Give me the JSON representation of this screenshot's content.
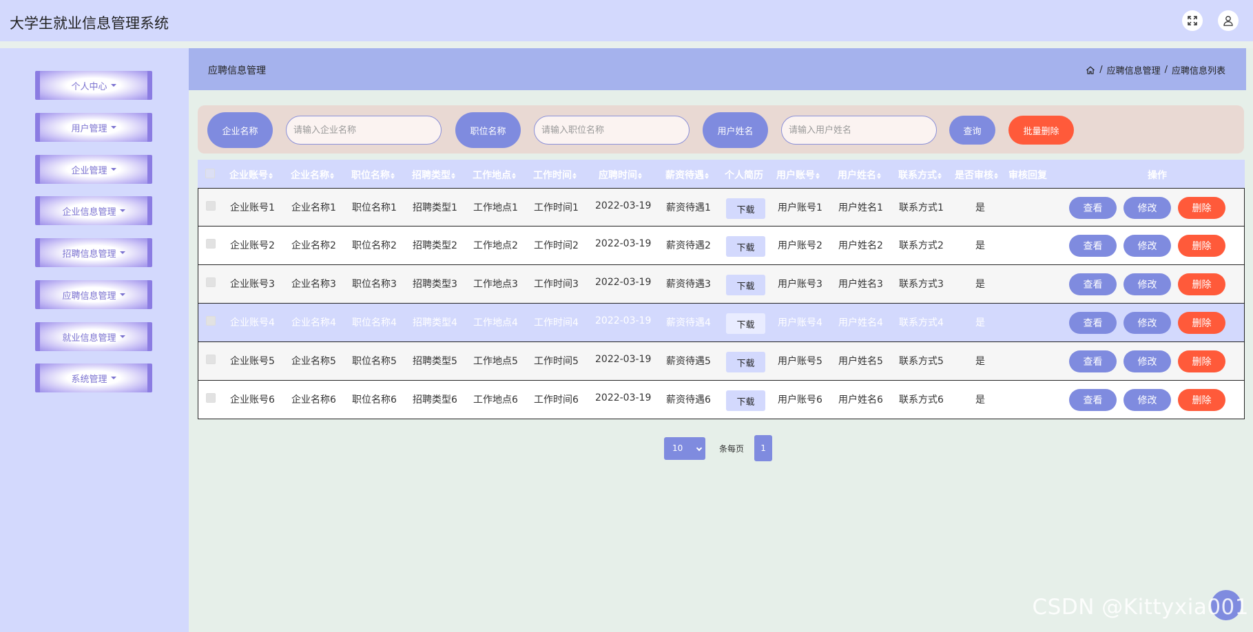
{
  "app": {
    "title": "大学生就业信息管理系统"
  },
  "sidebar": {
    "items": [
      {
        "label": "个人中心"
      },
      {
        "label": "用户管理"
      },
      {
        "label": "企业管理"
      },
      {
        "label": "企业信息管理"
      },
      {
        "label": "招聘信息管理"
      },
      {
        "label": "应聘信息管理"
      },
      {
        "label": "就业信息管理"
      },
      {
        "label": "系统管理"
      }
    ]
  },
  "page": {
    "title": "应聘信息管理",
    "breadcrumb": [
      "应聘信息管理",
      "应聘信息列表"
    ],
    "breadcrumb_sep": "/"
  },
  "search": {
    "company_label": "企业名称",
    "company_placeholder": "请输入企业名称",
    "position_label": "职位名称",
    "position_placeholder": "请输入职位名称",
    "user_label": "用户姓名",
    "user_placeholder": "请输入用户姓名",
    "query_label": "查询",
    "batch_delete_label": "批量删除"
  },
  "table": {
    "headers": [
      "企业账号",
      "企业名称",
      "职位名称",
      "招聘类型",
      "工作地点",
      "工作时间",
      "应聘时间",
      "薪资待遇",
      "个人简历",
      "用户账号",
      "用户姓名",
      "联系方式",
      "是否审核",
      "审核回复",
      "操作"
    ],
    "download_label": "下载",
    "view_label": "查看",
    "edit_label": "修改",
    "delete_label": "删除",
    "rows": [
      {
        "company_account": "企业账号1",
        "company_name": "企业名称1",
        "position": "职位名称1",
        "type": "招聘类型1",
        "location": "工作地点1",
        "work_time": "工作时间1",
        "apply_time": "2022-03-19",
        "salary": "薪资待遇1",
        "user_account": "用户账号1",
        "user_name": "用户姓名1",
        "contact": "联系方式1",
        "reviewed": "是"
      },
      {
        "company_account": "企业账号2",
        "company_name": "企业名称2",
        "position": "职位名称2",
        "type": "招聘类型2",
        "location": "工作地点2",
        "work_time": "工作时间2",
        "apply_time": "2022-03-19",
        "salary": "薪资待遇2",
        "user_account": "用户账号2",
        "user_name": "用户姓名2",
        "contact": "联系方式2",
        "reviewed": "是"
      },
      {
        "company_account": "企业账号3",
        "company_name": "企业名称3",
        "position": "职位名称3",
        "type": "招聘类型3",
        "location": "工作地点3",
        "work_time": "工作时间3",
        "apply_time": "2022-03-19",
        "salary": "薪资待遇3",
        "user_account": "用户账号3",
        "user_name": "用户姓名3",
        "contact": "联系方式3",
        "reviewed": "是"
      },
      {
        "company_account": "企业账号4",
        "company_name": "企业名称4",
        "position": "职位名称4",
        "type": "招聘类型4",
        "location": "工作地点4",
        "work_time": "工作时间4",
        "apply_time": "2022-03-19",
        "salary": "薪资待遇4",
        "user_account": "用户账号4",
        "user_name": "用户姓名4",
        "contact": "联系方式4",
        "reviewed": "是"
      },
      {
        "company_account": "企业账号5",
        "company_name": "企业名称5",
        "position": "职位名称5",
        "type": "招聘类型5",
        "location": "工作地点5",
        "work_time": "工作时间5",
        "apply_time": "2022-03-19",
        "salary": "薪资待遇5",
        "user_account": "用户账号5",
        "user_name": "用户姓名5",
        "contact": "联系方式5",
        "reviewed": "是"
      },
      {
        "company_account": "企业账号6",
        "company_name": "企业名称6",
        "position": "职位名称6",
        "type": "招聘类型6",
        "location": "工作地点6",
        "work_time": "工作时间6",
        "apply_time": "2022-03-19",
        "salary": "薪资待遇6",
        "user_account": "用户账号6",
        "user_name": "用户姓名6",
        "contact": "联系方式6",
        "reviewed": "是"
      }
    ]
  },
  "pagination": {
    "page_size": "10",
    "per_page_label": "条每页",
    "current_page": "1"
  },
  "watermark": "CSDN @Kittyxia001",
  "colors": {
    "accent": "#7f8bdf",
    "danger": "#ff5a3a",
    "sidebar_bg": "#d3d9fd",
    "page_head_bg": "#a5b2ed",
    "search_bg": "#e9d9d3"
  },
  "icons": {
    "expand": "fullscreen-icon",
    "user": "user-icon",
    "home": "home-icon"
  }
}
